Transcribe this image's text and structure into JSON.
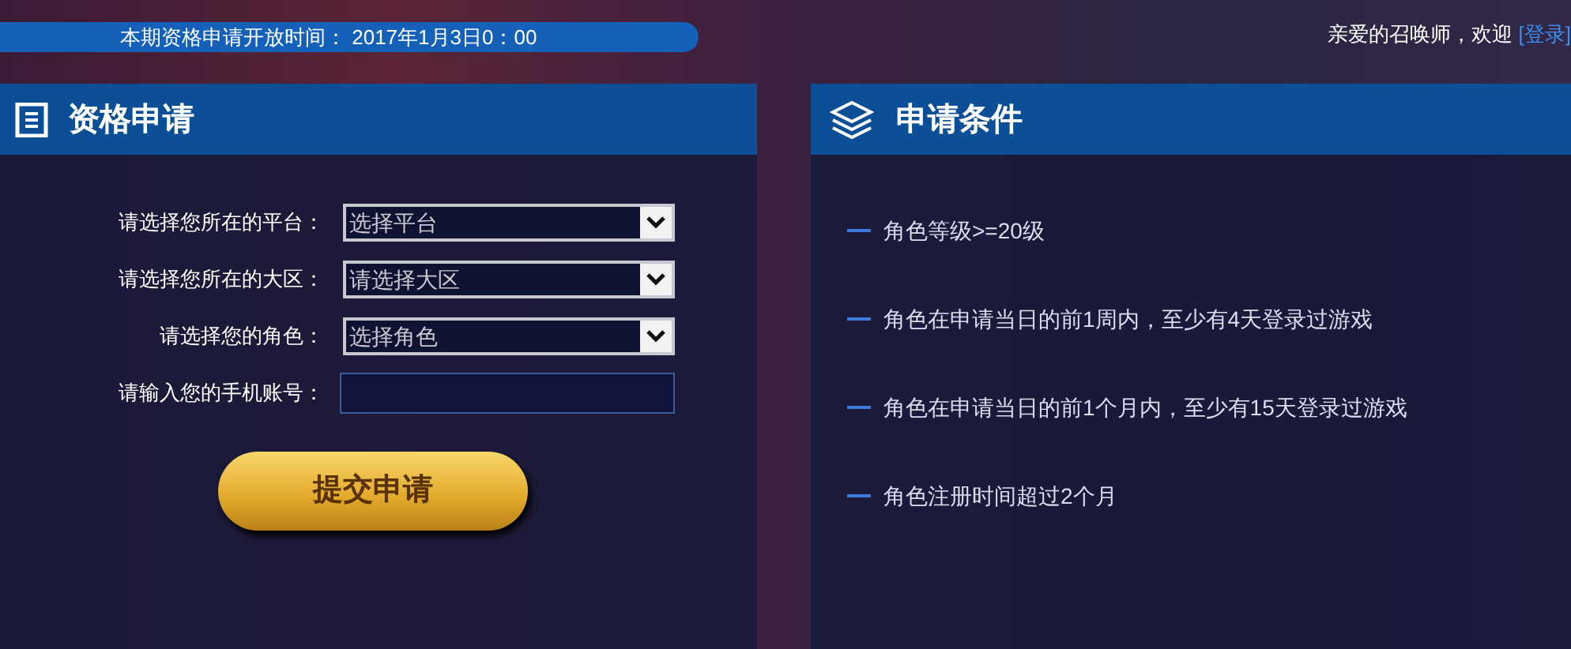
{
  "banner": {
    "text": "本期资格申请开放时间： 2017年1月3日0：00"
  },
  "welcome": {
    "text": "亲爱的召唤师，欢迎",
    "link": "[登录]"
  },
  "application_panel": {
    "title": "资格申请",
    "fields": [
      {
        "kind": "select",
        "label": "请选择您所在的平台：",
        "value": "选择平台"
      },
      {
        "kind": "select",
        "label": "请选择您所在的大区：",
        "value": "请选择大区"
      },
      {
        "kind": "select",
        "label": "请选择您的角色：",
        "value": "选择角色"
      },
      {
        "kind": "input",
        "label": "请输入您的手机账号："
      }
    ],
    "submit_button": "提交申请"
  },
  "conditions_panel": {
    "title": "申请条件",
    "items": [
      "角色等级>=20级",
      "角色在申请当日的前1周内，至少有4天登录过游戏",
      "角色在申请当日的前1个月内，至少有15天登录过游戏",
      "角色注册时间超过2个月"
    ]
  }
}
